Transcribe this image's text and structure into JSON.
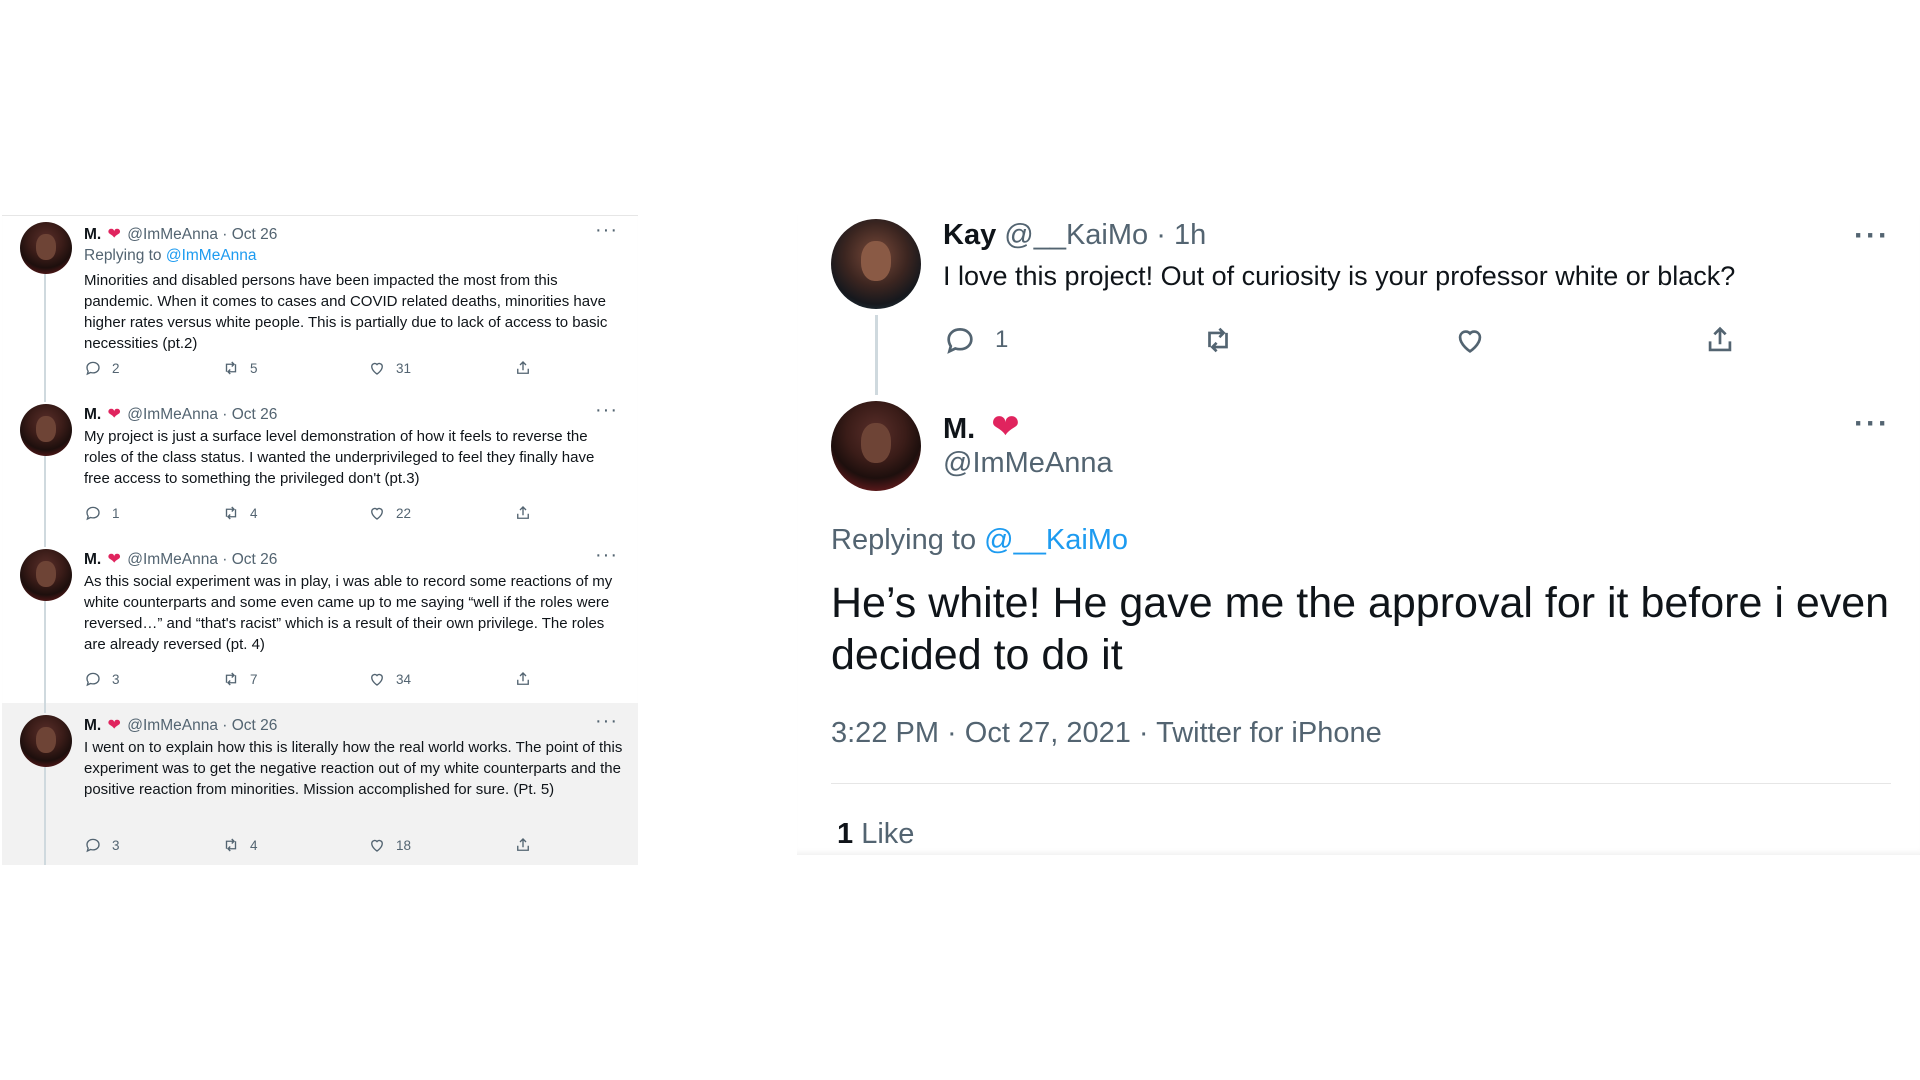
{
  "left_thread": {
    "tweets": [
      {
        "name": "M.",
        "handle": "@ImMeAnna",
        "date": "· Oct 26",
        "replying_prefix": "Replying to",
        "replying_to": "@ImMeAnna",
        "body": "Minorities and disabled persons have been impacted the most from this pandemic. When it comes to cases and COVID related deaths, minorities have higher rates versus white people. This is partially due to lack of access to basic necessities (pt.2)",
        "replies": "2",
        "retweets": "5",
        "likes": "31"
      },
      {
        "name": "M.",
        "handle": "@ImMeAnna",
        "date": "· Oct 26",
        "body": "My project is just a surface level demonstration of how it feels to reverse the roles of the class status. I wanted the underprivileged to feel they finally have free access to something the privileged don't (pt.3)",
        "replies": "1",
        "retweets": "4",
        "likes": "22"
      },
      {
        "name": "M.",
        "handle": "@ImMeAnna",
        "date": "· Oct 26",
        "body": "As this social experiment was in play, i was able to record some reactions of my white counterparts and some even came up to me saying “well if the roles were reversed…” and “that's racist” which is a result of their own privilege. The roles are already reversed (pt. 4)",
        "replies": "3",
        "retweets": "7",
        "likes": "34"
      },
      {
        "name": "M.",
        "handle": "@ImMeAnna",
        "date": "· Oct 26",
        "body": "I went on to explain how this is literally how the real world works. The point of this experiment was to get the negative reaction out of my white counterparts and the positive reaction from minorities. Mission accomplished for sure. (Pt. 5)",
        "replies": "3",
        "retweets": "4",
        "likes": "18"
      }
    ]
  },
  "right_tweet": {
    "parent": {
      "name": "Kay",
      "handle": "@__KaiMo",
      "time": "· 1h",
      "body": "I love this project! Out of curiosity is your professor white or black?",
      "replies": "1"
    },
    "main": {
      "name": "M.",
      "handle": "@ImMeAnna",
      "replying_prefix": "Replying to",
      "replying_to": "@__KaiMo",
      "body": "He’s white! He gave me the approval for it before i even decided to do it",
      "meta": "3:22 PM · Oct 27, 2021 · Twitter for iPhone",
      "likes_count": "1",
      "likes_label": "Like"
    }
  },
  "icons": {
    "more": "···",
    "heart": "❤"
  },
  "colors": {
    "link": "#1d9bf0",
    "secondary_text": "#536471",
    "heart": "#e0245e",
    "highlight_bg": "#f2f2f2"
  }
}
